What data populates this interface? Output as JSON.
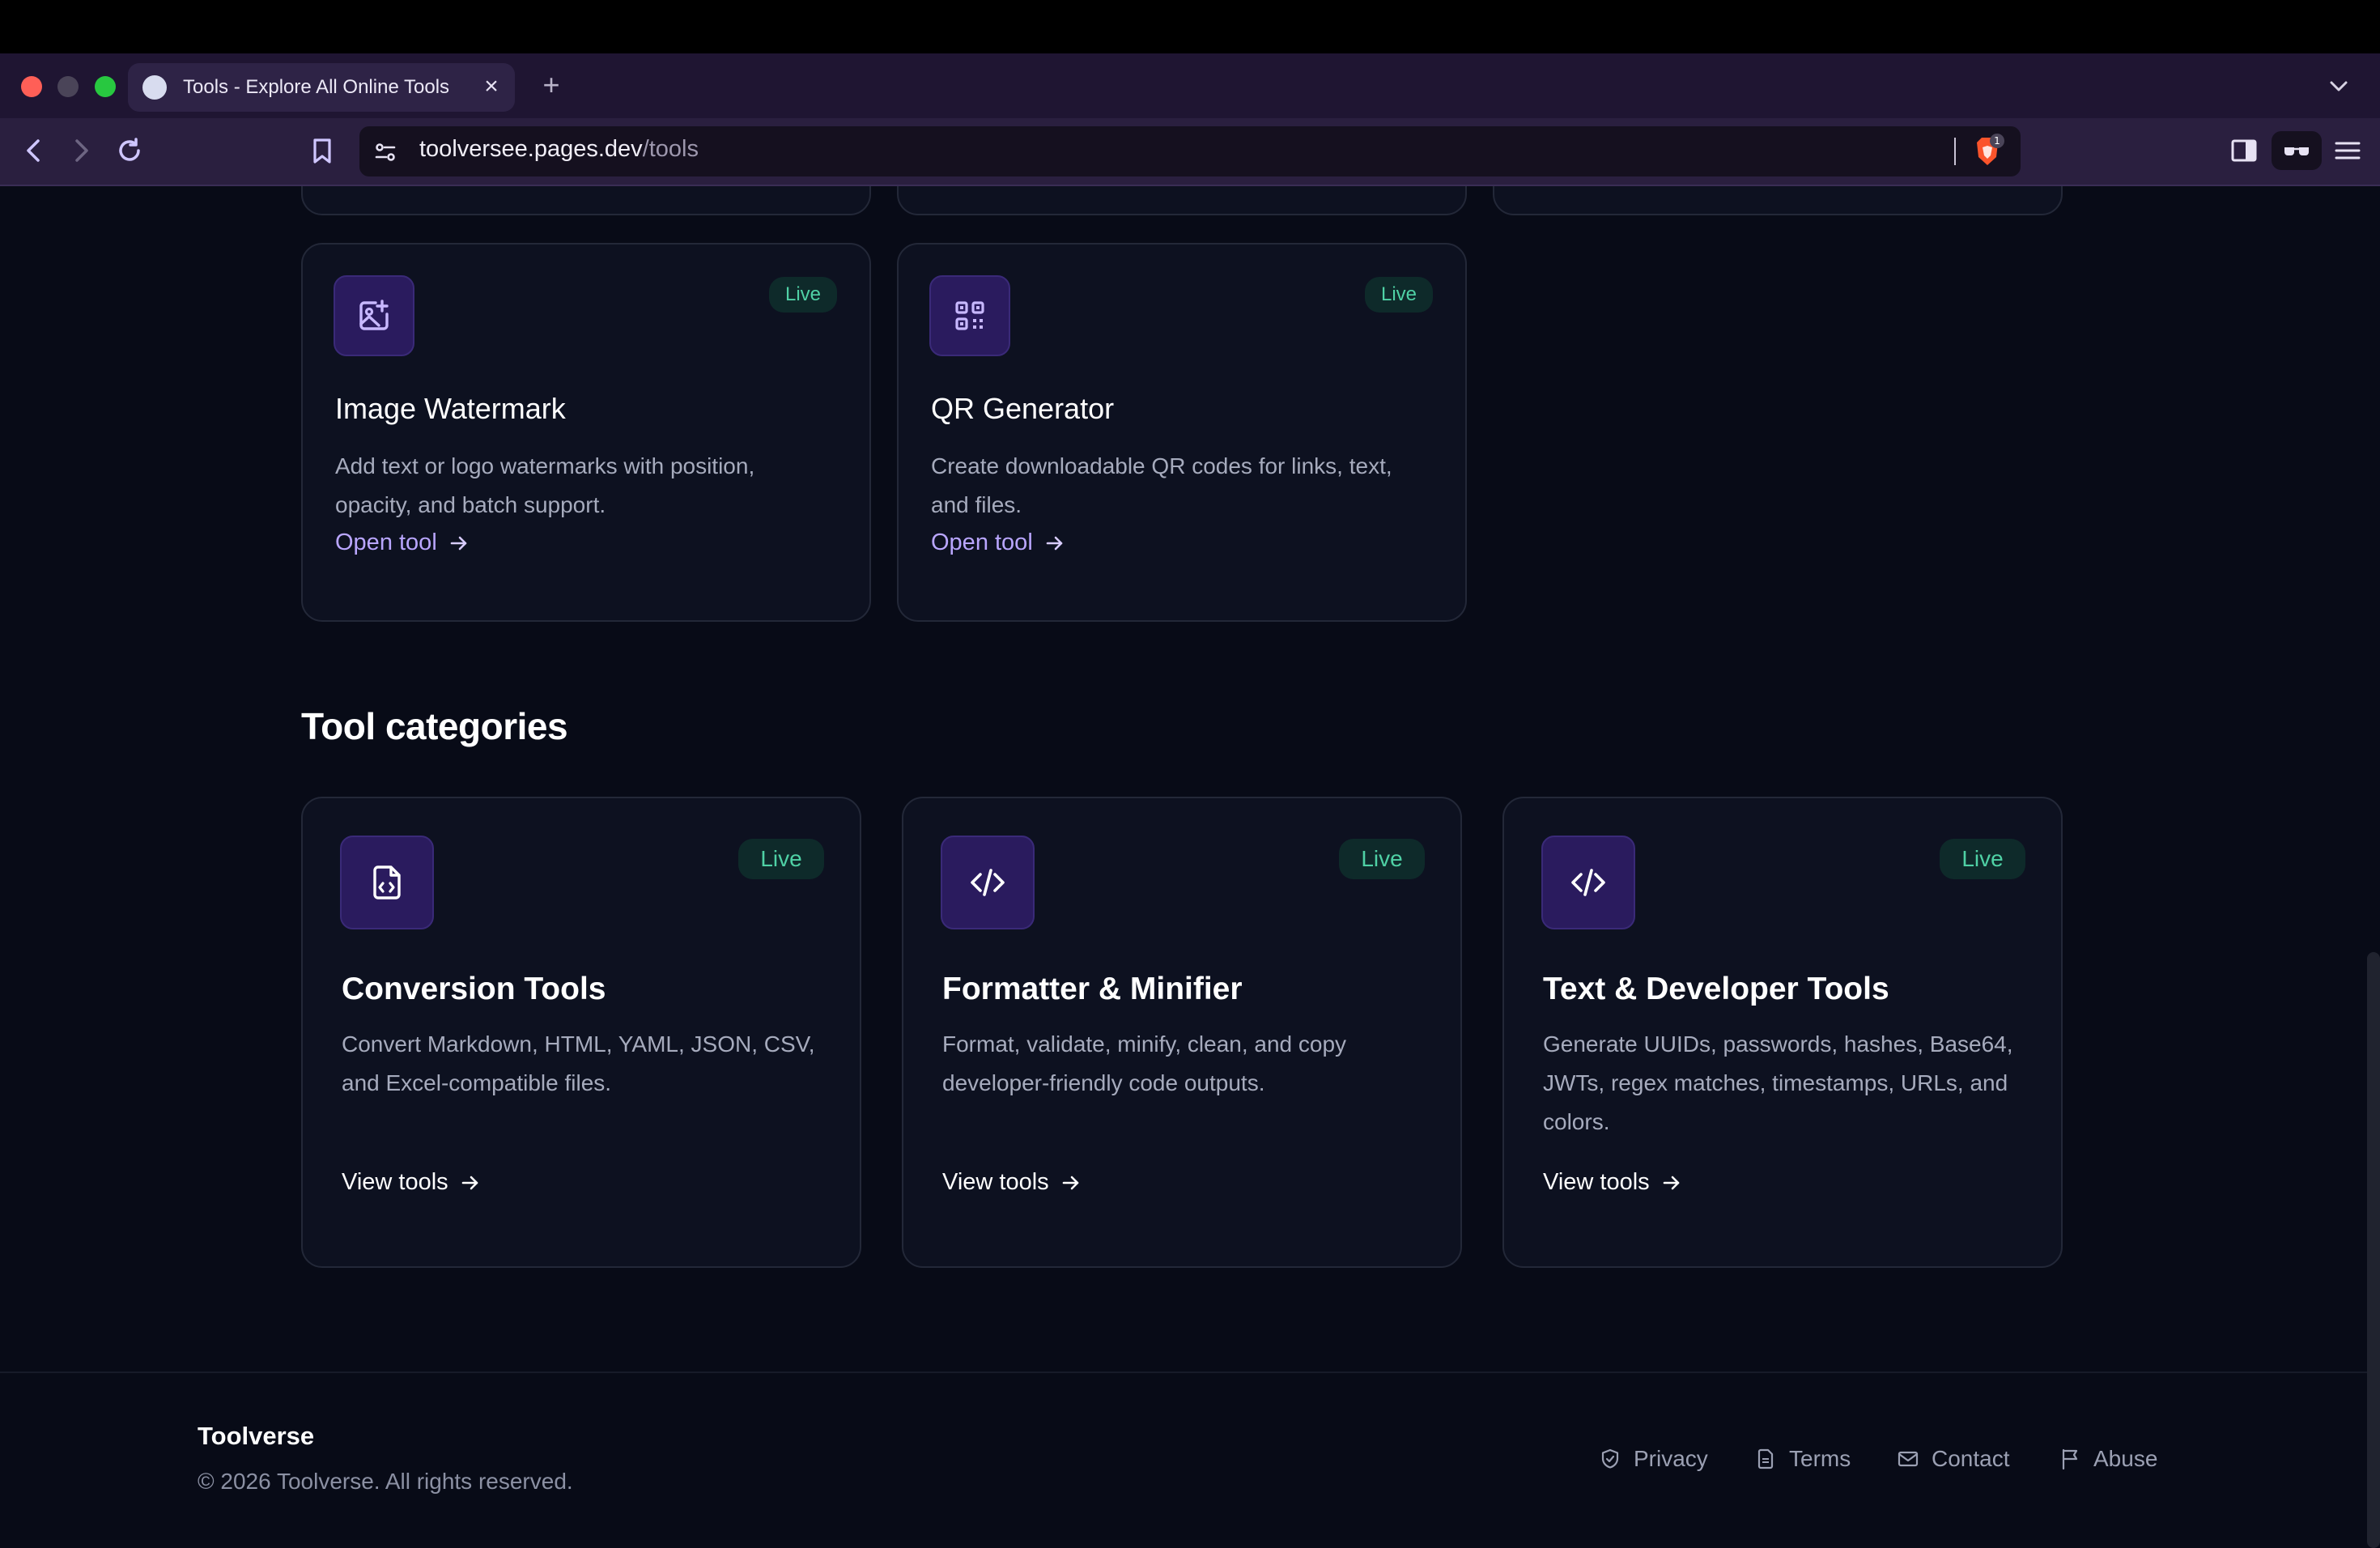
{
  "browser": {
    "tab_title": "Tools - Explore All Online Tools",
    "url_host": "toolversee.pages.dev",
    "url_path": "/tools",
    "shields_count": "1"
  },
  "tools": [
    {
      "title": "Image Watermark",
      "badge": "Live",
      "description": "Add text or logo watermarks with position, opacity, and batch support.",
      "link": "Open tool",
      "icon": "image-plus-icon"
    },
    {
      "title": "QR Generator",
      "badge": "Live",
      "description": "Create downloadable QR codes for links, text, and files.",
      "link": "Open tool",
      "icon": "qr-code-icon"
    }
  ],
  "categories_section": {
    "title": "Tool categories",
    "items": [
      {
        "title": "Conversion Tools",
        "badge": "Live",
        "description": "Convert Markdown, HTML, YAML, JSON, CSV, and Excel-compatible files.",
        "link": "View tools",
        "icon": "file-code-icon"
      },
      {
        "title": "Formatter & Minifier",
        "badge": "Live",
        "description": "Format, validate, minify, clean, and copy developer-friendly code outputs.",
        "link": "View tools",
        "icon": "code-icon"
      },
      {
        "title": "Text & Developer Tools",
        "badge": "Live",
        "description": "Generate UUIDs, passwords, hashes, Base64, JWTs, regex matches, timestamps, URLs, and colors.",
        "link": "View tools",
        "icon": "code-icon"
      }
    ]
  },
  "footer": {
    "brand": "Toolverse",
    "copyright": "© 2026 Toolverse. All rights reserved.",
    "links": [
      {
        "label": "Privacy",
        "icon": "shield-icon"
      },
      {
        "label": "Terms",
        "icon": "document-icon"
      },
      {
        "label": "Contact",
        "icon": "mail-icon"
      },
      {
        "label": "Abuse",
        "icon": "flag-icon"
      }
    ]
  },
  "colors": {
    "accent_purple": "#b9a6ff",
    "live_green": "#4fd1a5",
    "background": "#080b17"
  }
}
